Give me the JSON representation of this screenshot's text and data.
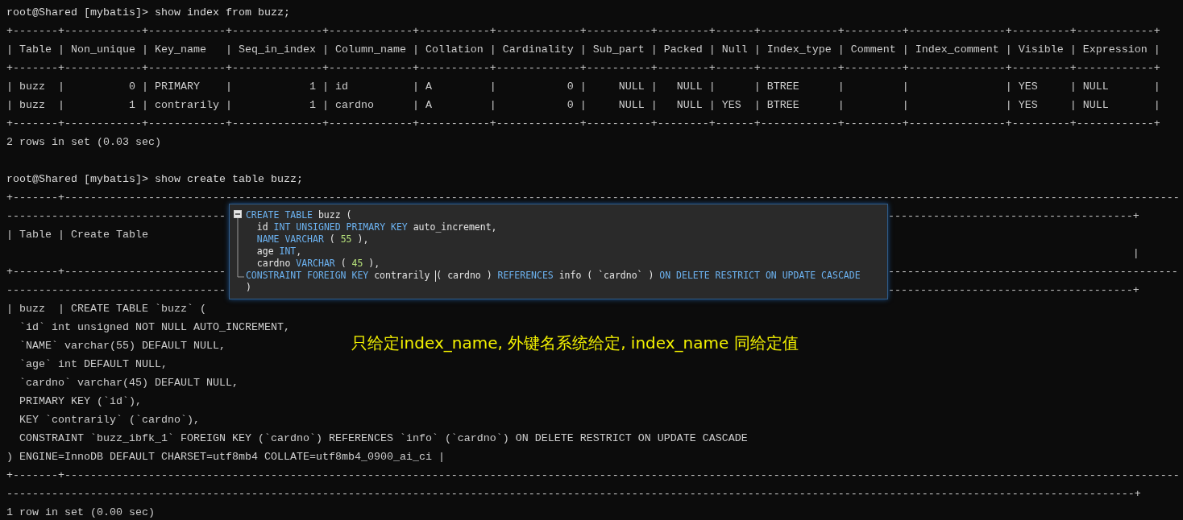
{
  "terminal": {
    "lines_before": [
      {
        "kind": "prompt",
        "text": "root@Shared [mybatis]> show index from buzz;"
      },
      {
        "kind": "output",
        "text": "+-------+------------+------------+--------------+-------------+-----------+-------------+----------+--------+------+------------+---------+---------------+---------+------------+"
      },
      {
        "kind": "output",
        "text": "| Table | Non_unique | Key_name   | Seq_in_index | Column_name | Collation | Cardinality | Sub_part | Packed | Null | Index_type | Comment | Index_comment | Visible | Expression |"
      },
      {
        "kind": "output",
        "text": "+-------+------------+------------+--------------+-------------+-----------+-------------+----------+--------+------+------------+---------+---------------+---------+------------+"
      },
      {
        "kind": "output",
        "text": "| buzz  |          0 | PRIMARY    |            1 | id          | A         |           0 |     NULL |   NULL |      | BTREE      |         |               | YES     | NULL       |"
      },
      {
        "kind": "output",
        "text": "| buzz  |          1 | contrarily |            1 | cardno      | A         |           0 |     NULL |   NULL | YES  | BTREE      |         |               | YES     | NULL       |"
      },
      {
        "kind": "output",
        "text": "+-------+------------+------------+--------------+-------------+-----------+-------------+----------+--------+------+------------+---------+---------------+---------+------------+"
      },
      {
        "kind": "output",
        "text": "2 rows in set (0.03 sec)"
      },
      {
        "kind": "blank"
      },
      {
        "kind": "prompt",
        "text": "root@Shared [mybatis]> show create table buzz;"
      },
      {
        "kind": "output",
        "text": "+-------+-----------------------------------------------------------------------------------------------------------------------------------------------------------------------------"
      }
    ],
    "lines_beside_popup": [
      {
        "left": "----------------------------------",
        "right": "--------------------------------------+"
      },
      {
        "left": "| Table | Create Table"
      },
      {
        "right": "|"
      },
      {
        "left": "+-------+-------------------------",
        "right": "---------------------------------------------"
      },
      {
        "left": "----------------------------------",
        "right": "--------------------------------------+"
      }
    ],
    "lines_after": [
      {
        "kind": "output",
        "text": "| buzz  | CREATE TABLE `buzz` ("
      },
      {
        "kind": "output",
        "text": "  `id` int unsigned NOT NULL AUTO_INCREMENT,"
      },
      {
        "kind": "output",
        "text": "  `NAME` varchar(55) DEFAULT NULL,"
      },
      {
        "kind": "output",
        "text": "  `age` int DEFAULT NULL,"
      },
      {
        "kind": "output",
        "text": "  `cardno` varchar(45) DEFAULT NULL,"
      },
      {
        "kind": "output",
        "text": "  PRIMARY KEY (`id`),"
      },
      {
        "kind": "output",
        "text": "  KEY `contrarily` (`cardno`),"
      },
      {
        "kind": "output",
        "text": "  CONSTRAINT `buzz_ibfk_1` FOREIGN KEY (`cardno`) REFERENCES `info` (`cardno`) ON DELETE RESTRICT ON UPDATE CASCADE"
      },
      {
        "kind": "output",
        "text": ") ENGINE=InnoDB DEFAULT CHARSET=utf8mb4 COLLATE=utf8mb4_0900_ai_ci |"
      },
      {
        "kind": "output",
        "text": "+-------+-----------------------------------------------------------------------------------------------------------------------------------------------------------------------------"
      },
      {
        "kind": "output",
        "text": "-------------------------------------------------------------------------------------------------------------------------------------------------------------------------------+"
      },
      {
        "kind": "output",
        "text": "1 row in set (0.00 sec)"
      }
    ]
  },
  "popup": {
    "lines": [
      {
        "indented": false,
        "tokens": [
          {
            "kind": "keyword",
            "text": "CREATE TABLE"
          },
          {
            "kind": "plain",
            "text": " buzz ("
          }
        ]
      },
      {
        "indented": true,
        "tokens": [
          {
            "kind": "plain",
            "text": "id "
          },
          {
            "kind": "keyword",
            "text": "INT UNSIGNED PRIMARY KEY"
          },
          {
            "kind": "plain",
            "text": " auto_increment,"
          }
        ]
      },
      {
        "indented": true,
        "tokens": [
          {
            "kind": "keyword",
            "text": "NAME VARCHAR"
          },
          {
            "kind": "plain",
            "text": " ( "
          },
          {
            "kind": "number",
            "text": "55"
          },
          {
            "kind": "plain",
            "text": " ),"
          }
        ]
      },
      {
        "indented": true,
        "tokens": [
          {
            "kind": "plain",
            "text": "age "
          },
          {
            "kind": "keyword",
            "text": "INT"
          },
          {
            "kind": "plain",
            "text": ","
          }
        ]
      },
      {
        "indented": true,
        "tokens": [
          {
            "kind": "plain",
            "text": "cardno "
          },
          {
            "kind": "keyword",
            "text": "VARCHAR"
          },
          {
            "kind": "plain",
            "text": " ( "
          },
          {
            "kind": "number",
            "text": "45"
          },
          {
            "kind": "plain",
            "text": " ),"
          }
        ]
      },
      {
        "indented": false,
        "tokens": [
          {
            "kind": "keyword",
            "text": "CONSTRAINT FOREIGN KEY"
          },
          {
            "kind": "plain",
            "text": " contrarily "
          },
          {
            "kind": "caret"
          },
          {
            "kind": "plain",
            "text": "( cardno ) "
          },
          {
            "kind": "keyword",
            "text": "REFERENCES"
          },
          {
            "kind": "plain",
            "text": " info ( `cardno` ) "
          },
          {
            "kind": "keyword",
            "text": "ON DELETE RESTRICT ON UPDATE CASCADE"
          }
        ]
      },
      {
        "indented": false,
        "tokens": [
          {
            "kind": "plain",
            "text": ")"
          }
        ]
      }
    ]
  },
  "annotation": {
    "text": "只给定index_name, 外键名系统给定, index_name 同给定值"
  }
}
